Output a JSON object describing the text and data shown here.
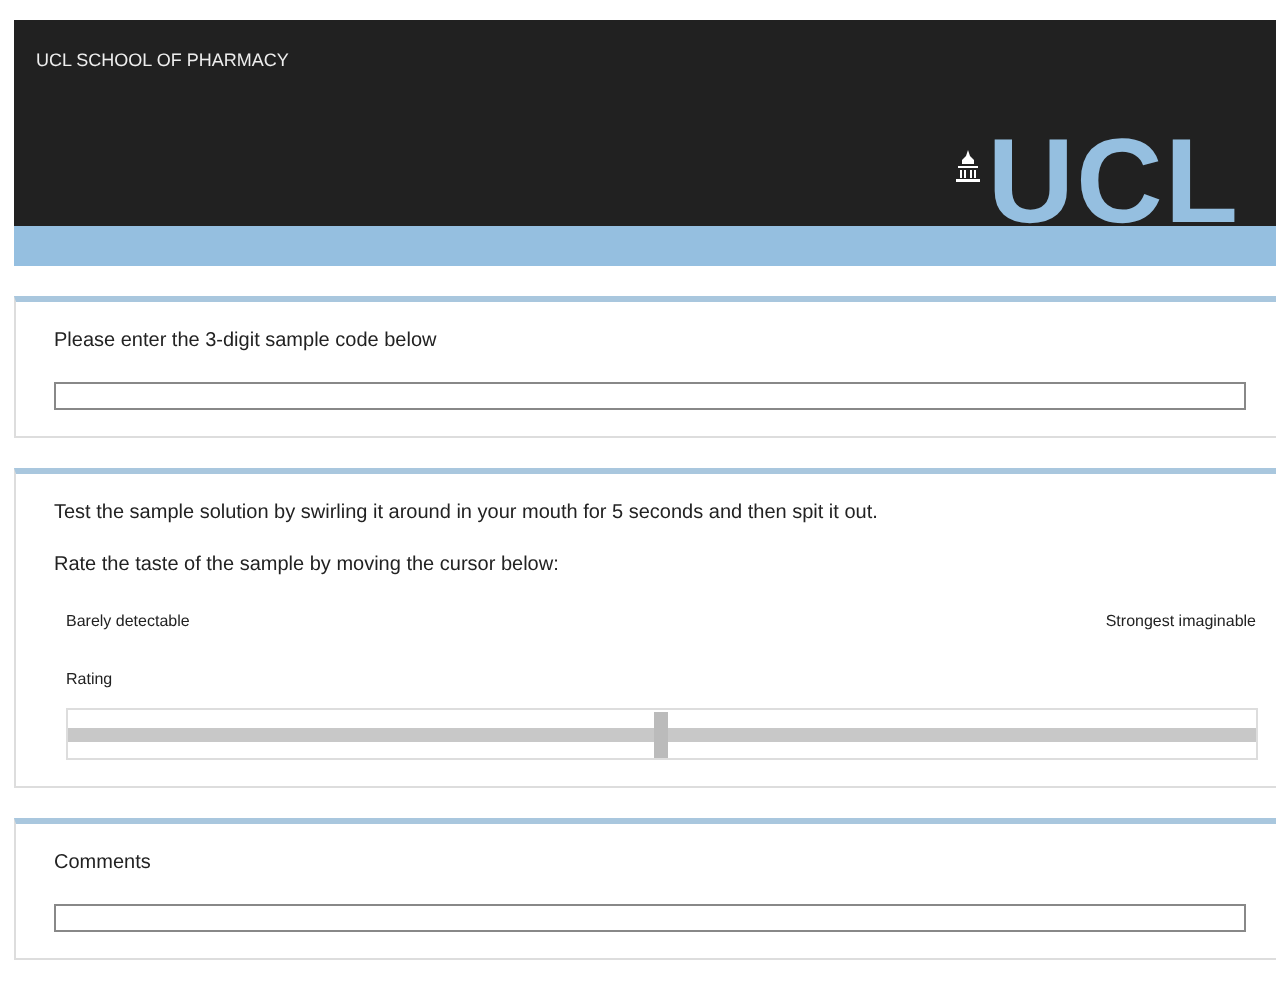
{
  "header": {
    "school": "UCL SCHOOL OF PHARMACY",
    "logo_text": "UCL"
  },
  "sections": [
    {
      "kind": "code",
      "prompt": "Please enter the 3-digit sample code below"
    },
    {
      "kind": "rating",
      "instruction": "Test the sample solution by swirling it around in your mouth for 5 seconds and then spit it out.",
      "prompt": "Rate the taste of the sample by moving the cursor below:",
      "min_label": "Barely detectable",
      "max_label": "Strongest imaginable",
      "slider_label": "Rating",
      "level": 0.5
    },
    {
      "kind": "comments",
      "prompt": "Comments"
    }
  ]
}
